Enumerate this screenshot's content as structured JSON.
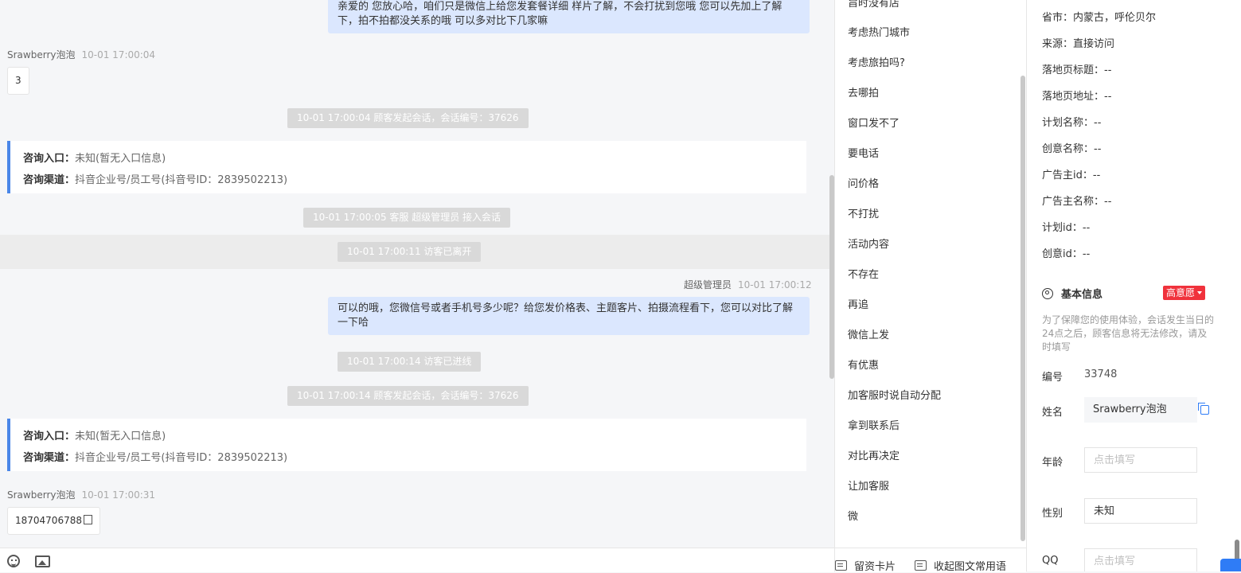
{
  "chat": {
    "msg_top_bubble": "亲爱的 您放心哈，咱们只是微信上给您发套餐详细 样片了解，不会打扰到您哦 您可以先加上了解下，拍不拍都没关系的哦 可以多对比下几家嘛",
    "msg1": {
      "sender": "Srawberry泡泡",
      "time": "10-01 17:00:04",
      "text": "3"
    },
    "sys1": "10-01 17:00:04 顾客发起会话，会话编号：37626",
    "entry1": {
      "label1": "咨询入口：",
      "value1": "未知(暂无入口信息)",
      "label2": "咨询渠道：",
      "value2": "抖音企业号/员工号(抖音号ID：2839502213)"
    },
    "sys2": "10-01 17:00:05 客服 超级管理员 接入会话",
    "sys3": "10-01 17:00:11 访客已离开",
    "msg2": {
      "sender": "超级管理员",
      "time": "10-01 17:00:12",
      "text": "可以的哦，您微信号或者手机号多少呢？给您发价格表、主题客片、拍摄流程看下，您可以对比了解一下哈"
    },
    "sys4": "10-01 17:00:14 访客已进线",
    "sys5": "10-01 17:00:14 顾客发起会话，会话编号：37626",
    "entry2": {
      "label1": "咨询入口：",
      "value1": "未知(暂无入口信息)",
      "label2": "咨询渠道：",
      "value2": "抖音企业号/员工号(抖音号ID：2839502213)"
    },
    "msg3": {
      "sender": "Srawberry泡泡",
      "time": "10-01 17:00:31",
      "text": "18704706788"
    }
  },
  "phrases": {
    "items": [
      "旨时没有店",
      "考虑热门城市",
      "考虑旅拍吗?",
      "去哪拍",
      "窗口发不了",
      "要电话",
      "问价格",
      "不打扰",
      "活动内容",
      "不存在",
      "再追",
      "微信上发",
      "有优惠",
      "加客服时说自动分配",
      "拿到联系后",
      "对比再决定",
      "让加客服",
      "微"
    ],
    "footer_card": "留资卡片",
    "footer_collapse": "收起图文常用语"
  },
  "info": {
    "rows": [
      {
        "label": "省市：",
        "value": "内蒙古，呼伦贝尔"
      },
      {
        "label": "来源：",
        "value": "直接访问"
      },
      {
        "label": "落地页标题：",
        "value": "--"
      },
      {
        "label": "落地页地址：",
        "value": "--"
      },
      {
        "label": "计划名称：",
        "value": "--"
      },
      {
        "label": "创意名称：",
        "value": "--"
      },
      {
        "label": "广告主id：",
        "value": "--"
      },
      {
        "label": "广告主名称：",
        "value": "--"
      },
      {
        "label": "计划id：",
        "value": "--"
      },
      {
        "label": "创意id：",
        "value": "--"
      }
    ],
    "section_title": "基本信息",
    "intent_badge": "高意愿",
    "notice": "为了保障您的使用体验，会话发生当日的24点之后，顾客信息将无法修改，请及时填写",
    "id_label": "编号",
    "id_value": "33748",
    "name_label": "姓名",
    "name_value": "Srawberry泡泡",
    "age_label": "年龄",
    "age_placeholder": "点击填写",
    "gender_label": "性别",
    "gender_value": "未知",
    "qq_label": "QQ",
    "qq_placeholder": "点击填写"
  },
  "colors": {
    "accent": "#2f7cf6",
    "badge": "#f0323c",
    "bubble": "#dbe7fe",
    "entry_border": "#4a86e8"
  }
}
